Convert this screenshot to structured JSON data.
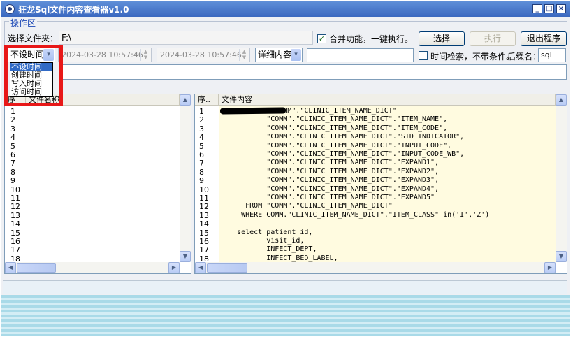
{
  "title": "狂龙Sql文件内容查看器v1.0",
  "window_buttons": {
    "minimize": "_",
    "maximize": "□",
    "close": "×"
  },
  "group_title": "操作区",
  "file": {
    "label": "选择文件夹：",
    "value": "F:\\"
  },
  "merge": {
    "checked": true,
    "label": "合并功能，一键执行。"
  },
  "buttons": {
    "select": "选择",
    "execute": "执行",
    "exit": "退出程序"
  },
  "time_mode": {
    "selected": "不设时间",
    "options": [
      "不设时间",
      "创建时间",
      "写入时间",
      "访问时间"
    ]
  },
  "start_datetime": "2024-03-28 10:57:46",
  "end_datetime": "2024-03-28 10:57:46",
  "detail": {
    "selected": "详细内容"
  },
  "search_value": "",
  "time_search": {
    "checked": false,
    "label": "时间检索，不带条件。"
  },
  "suffix": {
    "label": "后缀名：",
    "value": "sql"
  },
  "file_list": {
    "headers": [
      "序",
      "文件名称"
    ],
    "rows": [
      "1",
      "2",
      "3",
      "4",
      "5",
      "6",
      "7",
      "8",
      "9",
      "10",
      "11",
      "12",
      "13",
      "14",
      "15",
      "16",
      "17",
      "18"
    ]
  },
  "content": {
    "headers": [
      "序..",
      "文件内容"
    ],
    "rows": [
      {
        "n": "1",
        "text": "            \"COMM\".\"CLINIC_ITEM_NAME_DICT\""
      },
      {
        "n": "2",
        "text": "           \"COMM\".\"CLINIC_ITEM_NAME_DICT\".\"ITEM_NAME\","
      },
      {
        "n": "3",
        "text": "           \"COMM\".\"CLINIC_ITEM_NAME_DICT\".\"ITEM_CODE\","
      },
      {
        "n": "4",
        "text": "           \"COMM\".\"CLINIC_ITEM_NAME_DICT\".\"STD_INDICATOR\","
      },
      {
        "n": "5",
        "text": "           \"COMM\".\"CLINIC_ITEM_NAME_DICT\".\"INPUT_CODE\","
      },
      {
        "n": "6",
        "text": "           \"COMM\".\"CLINIC_ITEM_NAME_DICT\".\"INPUT_CODE_WB\","
      },
      {
        "n": "7",
        "text": "           \"COMM\".\"CLINIC_ITEM_NAME_DICT\".\"EXPAND1\","
      },
      {
        "n": "8",
        "text": "           \"COMM\".\"CLINIC_ITEM_NAME_DICT\".\"EXPAND2\","
      },
      {
        "n": "9",
        "text": "           \"COMM\".\"CLINIC_ITEM_NAME_DICT\".\"EXPAND3\","
      },
      {
        "n": "10",
        "text": "           \"COMM\".\"CLINIC_ITEM_NAME_DICT\".\"EXPAND4\","
      },
      {
        "n": "11",
        "text": "           \"COMM\".\"CLINIC_ITEM_NAME_DICT\".\"EXPAND5\""
      },
      {
        "n": "12",
        "text": "      FROM \"COMM\".\"CLINIC_ITEM_NAME_DICT\""
      },
      {
        "n": "13",
        "text": "     WHERE COMM.\"CLINIC_ITEM_NAME_DICT\".\"ITEM_CLASS\" in('I','Z')"
      },
      {
        "n": "14",
        "text": ""
      },
      {
        "n": "15",
        "text": "    select patient_id,"
      },
      {
        "n": "16",
        "text": "           visit_id,"
      },
      {
        "n": "17",
        "text": "           INFECT_DEPT,"
      },
      {
        "n": "18",
        "text": "           INFECT_BED_LABEL,"
      }
    ]
  },
  "icons": {
    "up": "▲",
    "down": "▼",
    "left": "◀",
    "right": "▶",
    "chevron": "▾"
  }
}
